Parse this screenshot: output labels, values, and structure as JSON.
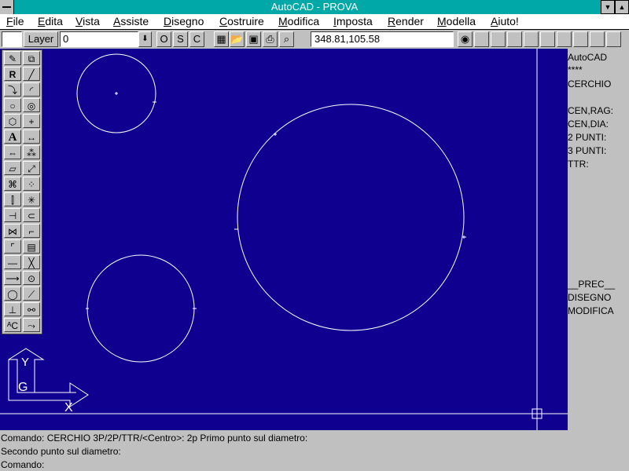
{
  "window": {
    "title": "AutoCAD - PROVA"
  },
  "menu": {
    "items": [
      "File",
      "Edita",
      "Vista",
      "Assiste",
      "Disegno",
      "Costruire",
      "Modifica",
      "Imposta",
      "Render",
      "Modella",
      "Aiuto!"
    ]
  },
  "toolbar": {
    "layer_label": "Layer",
    "layer_value": "0",
    "ortho": "O",
    "snap": "S",
    "coords_toggle": "C",
    "coordinates": "348.81,105.58"
  },
  "side_menu": {
    "title": "AutoCAD",
    "stars": "****",
    "heading": "CERCHIO",
    "options": [
      "CEN,RAG:",
      "CEN,DIA:",
      "2 PUNTI:",
      "3 PUNTI:",
      "TTR:"
    ],
    "footer": [
      "__PREC__",
      "DISEGNO",
      "MODIFICA"
    ]
  },
  "command_lines": [
    "Comando:  CERCHIO 3P/2P/TTR/<Centro>: 2p Primo punto sul diametro:",
    "Secondo punto sul diametro:",
    "Comando:"
  ],
  "palette": {
    "tools": [
      [
        "pencil-icon",
        "copy-icon"
      ],
      [
        "redraw-icon",
        "line-icon"
      ],
      [
        "polyline-icon",
        "arc-icon"
      ],
      [
        "circle-icon",
        "ellipse-icon"
      ],
      [
        "polygon-icon",
        "point-icon"
      ],
      [
        "text-icon",
        "dimension-icon"
      ],
      [
        "move-icon",
        "array-icon"
      ],
      [
        "erase-icon",
        "scale-icon"
      ],
      [
        "stretch-icon",
        "grid-array-icon"
      ],
      [
        "mirror-icon",
        "explode-icon"
      ],
      [
        "trim-icon",
        "offset-icon"
      ],
      [
        "break-icon",
        "fillet-icon"
      ],
      [
        "chamfer-icon",
        "hatch-icon"
      ],
      [
        "horizontal-line-icon",
        "x-icon"
      ],
      [
        "extend-icon",
        "snap-center-icon"
      ],
      [
        "donut-icon",
        "slash-icon"
      ],
      [
        "ucs-icon",
        "tangent-icon"
      ],
      [
        "edit-text-icon",
        "block-icon"
      ]
    ],
    "glyphs": {
      "redraw-icon": "R",
      "text-icon": "A",
      "edit-text-icon": "ᴬC"
    }
  },
  "ucs_icon": {
    "y_label": "Y",
    "x_label": "X",
    "g_label": "G"
  },
  "colors": {
    "canvas": "#0f0090",
    "title_bar": "#00a8a8",
    "drawing": "#ffffff"
  }
}
